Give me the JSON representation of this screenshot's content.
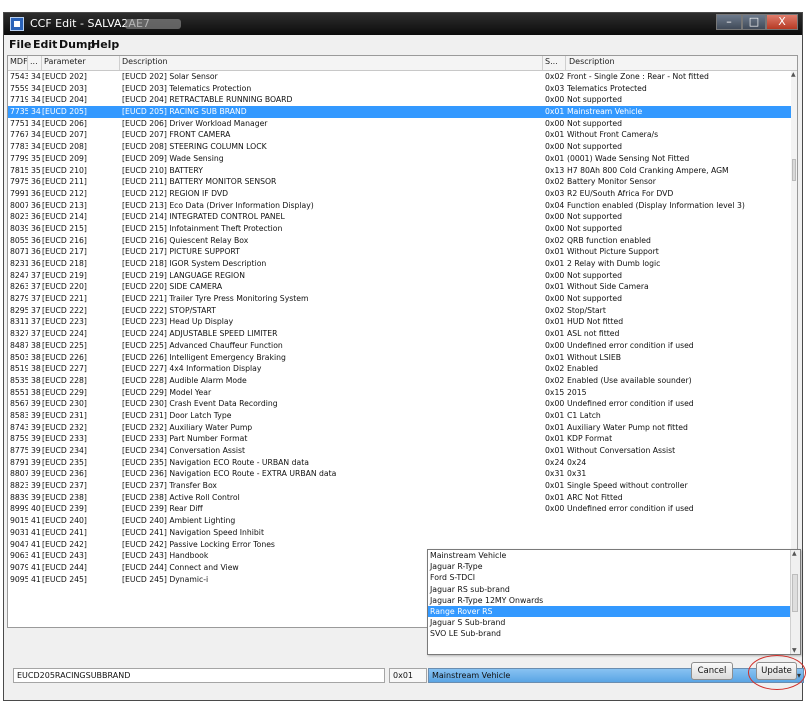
{
  "title": {
    "text": "CCF Edit - SALVA2AE7"
  },
  "window_controls": {
    "min": "–",
    "max": "□",
    "close": "X"
  },
  "menu": {
    "items": [
      "File",
      "Edit",
      "Dump",
      "Help"
    ]
  },
  "table": {
    "columns": [
      "MDF",
      "...",
      "Parameter",
      "Description",
      "S...",
      "Description"
    ],
    "rows": [
      [
        "7543",
        "342",
        "[EUCD 202]",
        "[EUCD 202] Solar Sensor",
        "0x02",
        "Front - Single Zone : Rear - Not fitted"
      ],
      [
        "7559",
        "343",
        "[EUCD 203]",
        "[EUCD 203] Telematics Protection",
        "0x03",
        "Telematics Protected"
      ],
      [
        "7719",
        "345",
        "[EUCD 204]",
        "[EUCD 204] RETRACTABLE RUNNING BOARD",
        "0x00",
        "Not supported"
      ],
      [
        "7735",
        "346",
        "[EUCD 205]",
        "[EUCD 205] RACING SUB BRAND",
        "0x01",
        "Mainstream Vehicle"
      ],
      [
        "7751",
        "347",
        "[EUCD 206]",
        "[EUCD 206] Driver Workload Manager",
        "0x00",
        "Not supported"
      ],
      [
        "7767",
        "348",
        "[EUCD 207]",
        "[EUCD 207] FRONT CAMERA",
        "0x01",
        "Without Front Camera/s"
      ],
      [
        "7783",
        "349",
        "[EUCD 208]",
        "[EUCD 208] STEERING COLUMN LOCK",
        "0x00",
        "Not supported"
      ],
      [
        "7799",
        "350",
        "[EUCD 209]",
        "[EUCD 209] Wade Sensing",
        "0x01",
        "(0001) Wade Sensing Not Fitted"
      ],
      [
        "7815",
        "351",
        "[EUCD 210]",
        "[EUCD 210] BATTERY",
        "0x13",
        "H7 80Ah 800 Cold Cranking Ampere, AGM"
      ],
      [
        "7975",
        "361",
        "[EUCD 211]",
        "[EUCD 211] BATTERY MONITOR SENSOR",
        "0x02",
        "Battery Monitor Sensor"
      ],
      [
        "7991",
        "362",
        "[EUCD 212]",
        "[EUCD 212] REGION IF DVD",
        "0x03",
        "R2 EU/South Africa For DVD"
      ],
      [
        "8007",
        "363",
        "[EUCD 213]",
        "[EUCD 213] Eco Data (Driver Information Display)",
        "0x04",
        "Function enabled (Display Information level 3)"
      ],
      [
        "8023",
        "364",
        "[EUCD 214]",
        "[EUCD 214] INTEGRATED CONTROL PANEL",
        "0x00",
        "Not supported"
      ],
      [
        "8039",
        "365",
        "[EUCD 215]",
        "[EUCD 215] Infotainment Theft Protection",
        "0x00",
        "Not supported"
      ],
      [
        "8055",
        "366",
        "[EUCD 216]",
        "[EUCD 216] Quiescent Relay Box",
        "0x02",
        "QRB function enabled"
      ],
      [
        "8071",
        "367",
        "[EUCD 217]",
        "[EUCD 217] PICTURE SUPPORT",
        "0x01",
        "Without Picture Support"
      ],
      [
        "8231",
        "369",
        "[EUCD 218]",
        "[EUCD 218] IGOR System Description",
        "0x01",
        "2 Relay with Dumb logic"
      ],
      [
        "8247",
        "370",
        "[EUCD 219]",
        "[EUCD 219] LANGUAGE REGION",
        "0x00",
        "Not supported"
      ],
      [
        "8263",
        "371",
        "[EUCD 220]",
        "[EUCD 220] SIDE CAMERA",
        "0x01",
        "Without Side Camera"
      ],
      [
        "8279",
        "372",
        "[EUCD 221]",
        "[EUCD 221] Trailer Tyre Press Monitoring System",
        "0x00",
        "Not supported"
      ],
      [
        "8295",
        "373",
        "[EUCD 222]",
        "[EUCD 222] STOP/START",
        "0x02",
        "Stop/Start"
      ],
      [
        "8311",
        "374",
        "[EUCD 223]",
        "[EUCD 223] Head Up Display",
        "0x01",
        "HUD Not fitted"
      ],
      [
        "8327",
        "375",
        "[EUCD 224]",
        "[EUCD 224] ADJUSTABLE SPEED LIMITER",
        "0x01",
        "ASL not fitted"
      ],
      [
        "8487",
        "385",
        "[EUCD 225]",
        "[EUCD 225] Advanced Chauffeur Function",
        "0x00",
        "Undefined error condition if used"
      ],
      [
        "8503",
        "386",
        "[EUCD 226]",
        "[EUCD 226] Intelligent Emergency Braking",
        "0x01",
        "Without LSIEB"
      ],
      [
        "8519",
        "387",
        "[EUCD 227]",
        "[EUCD 227] 4x4 Information Display",
        "0x02",
        "Enabled"
      ],
      [
        "8535",
        "388",
        "[EUCD 228]",
        "[EUCD 228] Audible Alarm Mode",
        "0x02",
        "Enabled (Use available sounder)"
      ],
      [
        "8551",
        "389",
        "[EUCD 229]",
        "[EUCD 229] Model Year",
        "0x15",
        "2015"
      ],
      [
        "8567",
        "390",
        "[EUCD 230]",
        "[EUCD 230] Crash Event Data Recording",
        "0x00",
        "Undefined error condition if used"
      ],
      [
        "8583",
        "391",
        "[EUCD 231]",
        "[EUCD 231] Door Latch Type",
        "0x01",
        "C1 Latch"
      ],
      [
        "8743",
        "393",
        "[EUCD 232]",
        "[EUCD 232] Auxiliary Water Pump",
        "0x01",
        "Auxiliary Water Pump not fitted"
      ],
      [
        "8759",
        "394",
        "[EUCD 233]",
        "[EUCD 233] Part Number Format",
        "0x01",
        "KDP Format"
      ],
      [
        "8775",
        "395",
        "[EUCD 234]",
        "[EUCD 234] Conversation Assist",
        "0x01",
        "Without Conversation Assist"
      ],
      [
        "8791",
        "396",
        "[EUCD 235]",
        "[EUCD 235] Navigation ECO Route - URBAN data",
        "0x24",
        "0x24"
      ],
      [
        "8807",
        "397",
        "[EUCD 236]",
        "[EUCD 236] Navigation ECO Route - EXTRA URBAN data",
        "0x31",
        "0x31"
      ],
      [
        "8823",
        "398",
        "[EUCD 237]",
        "[EUCD 237] Transfer Box",
        "0x01",
        "Single Speed without controller"
      ],
      [
        "8839",
        "399",
        "[EUCD 238]",
        "[EUCD 238] Active Roll Control",
        "0x01",
        "ARC Not Fitted"
      ],
      [
        "8999",
        "409",
        "[EUCD 239]",
        "[EUCD 239] Rear Diff",
        "0x00",
        "Undefined error condition if used"
      ],
      [
        "9015",
        "410",
        "[EUCD 240]",
        "[EUCD 240] Ambient Lighting",
        "",
        ""
      ],
      [
        "9031",
        "411",
        "[EUCD 241]",
        "[EUCD 241] Navigation Speed Inhibit",
        "",
        ""
      ],
      [
        "9047",
        "412",
        "[EUCD 242]",
        "[EUCD 242] Passive Locking Error Tones",
        "",
        ""
      ],
      [
        "9063",
        "413",
        "[EUCD 243]",
        "[EUCD 243] Handbook",
        "",
        ""
      ],
      [
        "9079",
        "414",
        "[EUCD 244]",
        "[EUCD 244] Connect and View",
        "",
        ""
      ],
      [
        "9095",
        "415",
        "[EUCD 245]",
        "[EUCD 245] Dynamic-i",
        "",
        ""
      ]
    ],
    "selected_index": 3
  },
  "dropdown": {
    "options": [
      "Mainstream Vehicle",
      "Jaguar R-Type",
      "Ford S-TDCI",
      "Jaguar RS sub-brand",
      "Jaguar R-Type 12MY Onwards",
      "Range Rover RS",
      "Jaguar S Sub-brand",
      "SVO LE Sub-brand"
    ],
    "highlighted_index": 5
  },
  "bottom": {
    "param_name": "EUCD205RACINGSUBBRAND",
    "hex_value": "0x01",
    "selected_value": "Mainstream Vehicle",
    "cancel_label": "Cancel",
    "update_label": "Update"
  },
  "colors": {
    "selection": "#3399ff",
    "annotation_circle": "#d0302a"
  }
}
